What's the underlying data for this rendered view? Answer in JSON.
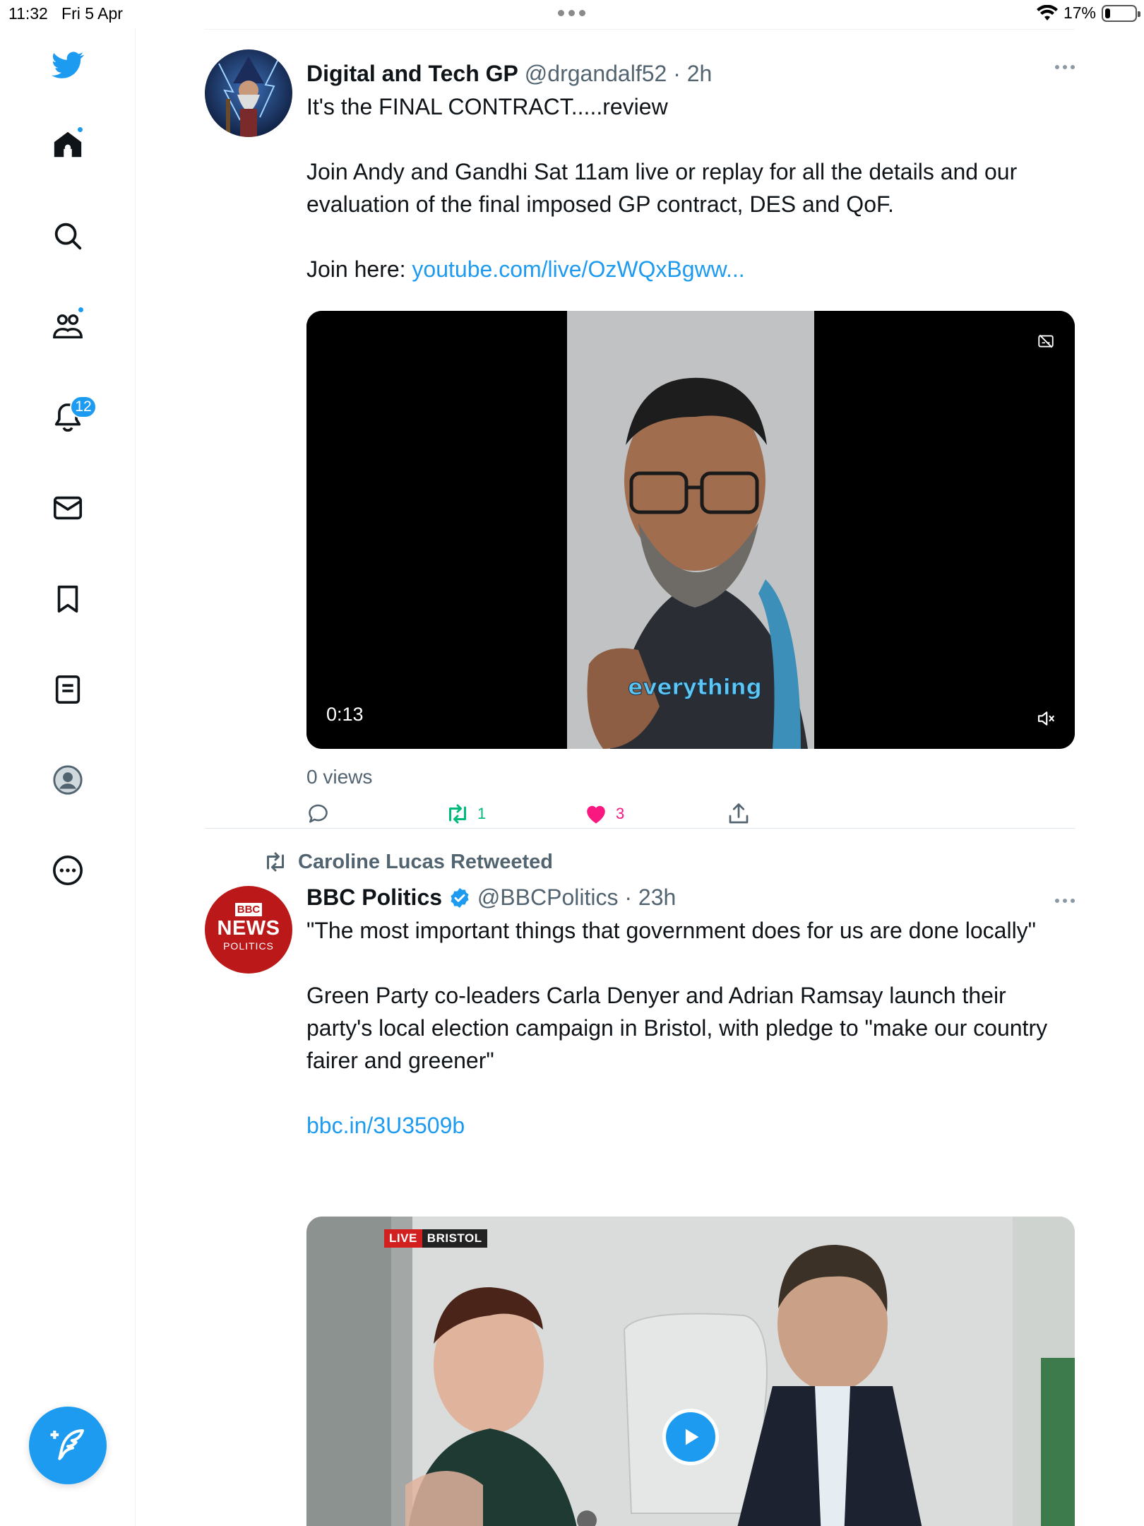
{
  "status_bar": {
    "time": "11:32",
    "date": "Fri 5 Apr",
    "battery": "17%",
    "battery_level": 0.17
  },
  "sidebar": {
    "notifications_badge": "12"
  },
  "tweets": [
    {
      "author": "Digital and Tech GP",
      "handle": "@drgandalf52",
      "time": "2h",
      "text_line1": "It's the FINAL CONTRACT.....review",
      "text_line2": "Join Andy and Gandhi Sat 11am live or replay for all the details and our evaluation of the final imposed GP contract, DES and QoF.",
      "text_line3_prefix": "Join here:",
      "link": "youtube.com/live/OzWQxBgww...",
      "video_time": "0:13",
      "caption": "everything",
      "views": "0 views",
      "retweets": "1",
      "likes": "3"
    },
    {
      "retweet_context": "Caroline Lucas Retweeted",
      "author": "BBC Politics",
      "handle": "@BBCPolitics",
      "time": "23h",
      "text_line1": "\"The most important things that government does for us are done locally\"",
      "text_line2": "Green Party co-leaders Carla Denyer and Adrian Ramsay launch their party's local election campaign in Bristol, with pledge to \"make our country fairer and greener\"",
      "link": "bbc.in/3U3509b",
      "avatar_text": {
        "top": "BBC",
        "middle": "NEWS",
        "bottom": "POLITICS"
      },
      "media_badge_live": "LIVE",
      "media_badge_place": "BRISTOL"
    }
  ],
  "colors": {
    "accent": "#1d9bf0",
    "retweet": "#00ba7c",
    "like": "#f91880",
    "bbc_red": "#bb1919"
  }
}
